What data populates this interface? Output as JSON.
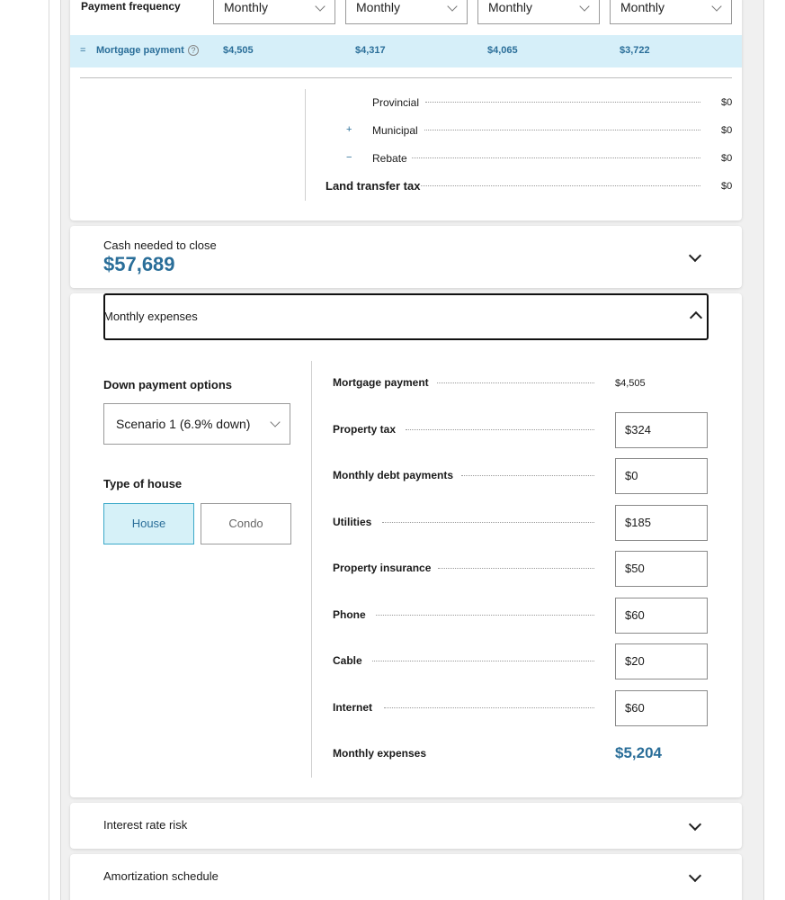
{
  "payment_frequency": {
    "label": "Payment frequency",
    "selects": [
      "Monthly",
      "Monthly",
      "Monthly",
      "Monthly"
    ]
  },
  "mortgage_row": {
    "sign": "=",
    "label": "Mortgage payment",
    "help": "?",
    "values": [
      "$4,505",
      "$4,317",
      "$4,065",
      "$3,722"
    ]
  },
  "land_transfer": {
    "rows": [
      {
        "sign": "",
        "label": "Provincial",
        "value": "$0"
      },
      {
        "sign": "+",
        "label": "Municipal",
        "value": "$0"
      },
      {
        "sign": "−",
        "label": "Rebate",
        "value": "$0"
      },
      {
        "sign": "",
        "label": "Land transfer tax",
        "value": "$0"
      }
    ]
  },
  "cash_needed": {
    "label": "Cash needed to close",
    "value": "$57,689"
  },
  "monthly_expenses": {
    "header": "Monthly expenses",
    "down_payment_label": "Down payment options",
    "scenario": "Scenario 1 (6.9% down)",
    "type_of_house_label": "Type of house",
    "house_options": [
      "House",
      "Condo"
    ],
    "selected_house": "House",
    "mortgage_payment_label": "Mortgage payment",
    "mortgage_payment_value": "$4,505",
    "inputs": [
      {
        "label": "Property tax",
        "value": "$324"
      },
      {
        "label": "Monthly debt payments",
        "value": "$0"
      },
      {
        "label": "Utilities",
        "value": "$185"
      },
      {
        "label": "Property insurance",
        "value": "$50"
      },
      {
        "label": "Phone",
        "value": "$60"
      },
      {
        "label": "Cable",
        "value": "$20"
      },
      {
        "label": "Internet",
        "value": "$60"
      }
    ],
    "total_label": "Monthly expenses",
    "total_value": "$5,204"
  },
  "interest_rate_risk": {
    "label": "Interest rate risk"
  },
  "amortization_schedule": {
    "label": "Amortization schedule"
  },
  "colors": {
    "accent": "#2a6e99",
    "highlight_row": "#d6eff9",
    "selected_bg": "#d6f1f8"
  }
}
